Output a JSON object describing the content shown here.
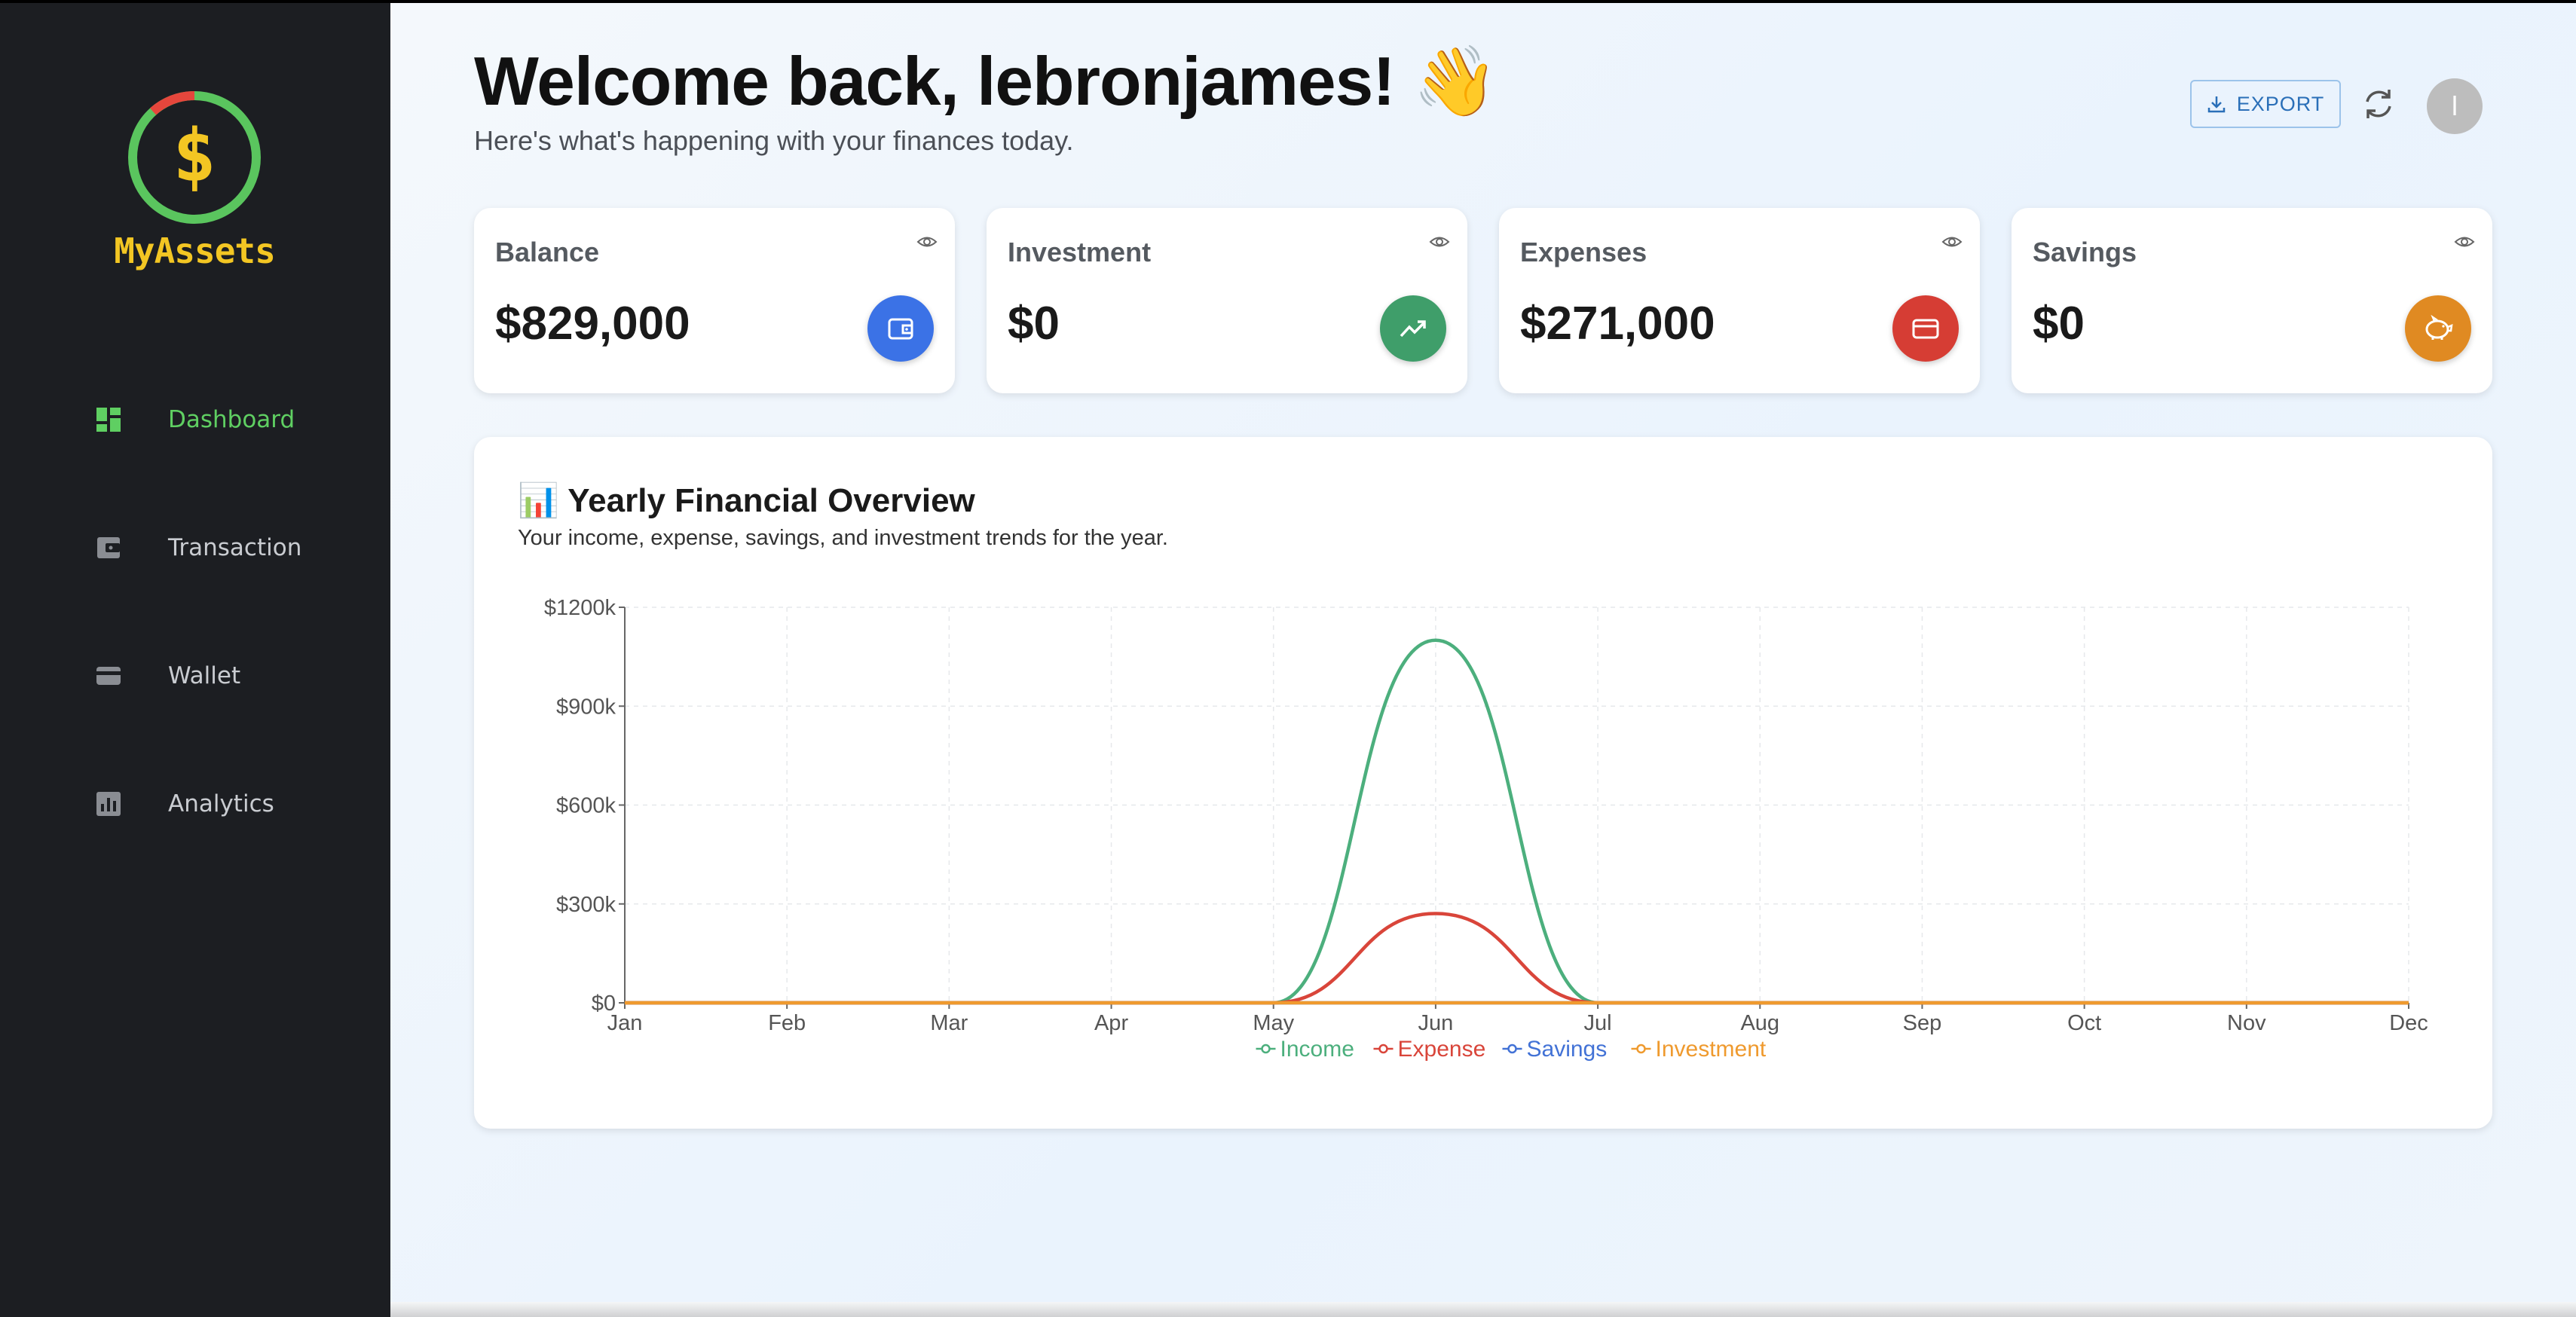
{
  "app": {
    "logo_text": "MyAssets",
    "logo_symbol": "$"
  },
  "sidebar": {
    "items": [
      {
        "label": "Dashboard",
        "icon": "dashboard-icon",
        "active": true
      },
      {
        "label": "Transaction",
        "icon": "wallet-icon",
        "active": false
      },
      {
        "label": "Wallet",
        "icon": "credit-card-icon",
        "active": false
      },
      {
        "label": "Analytics",
        "icon": "analytics-icon",
        "active": false
      }
    ]
  },
  "header": {
    "welcome": "Welcome back, lebronjames! 👋",
    "subtitle": "Here's what's happening with your finances today.",
    "export_label": "EXPORT",
    "avatar_initial": "l"
  },
  "cards": [
    {
      "title": "Balance",
      "value": "$829,000",
      "icon": "wallet-icon",
      "color": "#3b72e6"
    },
    {
      "title": "Investment",
      "value": "$0",
      "icon": "trending-up-icon",
      "color": "#3f9e6a"
    },
    {
      "title": "Expenses",
      "value": "$271,000",
      "icon": "credit-card-icon",
      "color": "#d63d34"
    },
    {
      "title": "Savings",
      "value": "$0",
      "icon": "piggy-bank-icon",
      "color": "#e08a22"
    }
  ],
  "chart": {
    "title_icon": "📊",
    "title": "Yearly Financial Overview",
    "subtitle": "Your income, expense, savings, and investment trends for the year."
  },
  "chart_data": {
    "type": "line",
    "categories": [
      "Jan",
      "Feb",
      "Mar",
      "Apr",
      "May",
      "Jun",
      "Jul",
      "Aug",
      "Sep",
      "Oct",
      "Nov",
      "Dec"
    ],
    "y_ticks": [
      "$0",
      "$300k",
      "$600k",
      "$900k",
      "$1200k"
    ],
    "ylim": [
      0,
      1200000
    ],
    "grid": true,
    "legend_position": "bottom",
    "series": [
      {
        "name": "Income",
        "color": "#4caf7d",
        "values": [
          0,
          0,
          0,
          0,
          0,
          1100000,
          0,
          0,
          0,
          0,
          0,
          0
        ]
      },
      {
        "name": "Expense",
        "color": "#d9453a",
        "values": [
          0,
          0,
          0,
          0,
          0,
          271000,
          0,
          0,
          0,
          0,
          0,
          0
        ]
      },
      {
        "name": "Savings",
        "color": "#4272d6",
        "values": [
          0,
          0,
          0,
          0,
          0,
          0,
          0,
          0,
          0,
          0,
          0,
          0
        ]
      },
      {
        "name": "Investment",
        "color": "#ef9a2e",
        "values": [
          0,
          0,
          0,
          0,
          0,
          0,
          0,
          0,
          0,
          0,
          0,
          0
        ]
      }
    ]
  }
}
